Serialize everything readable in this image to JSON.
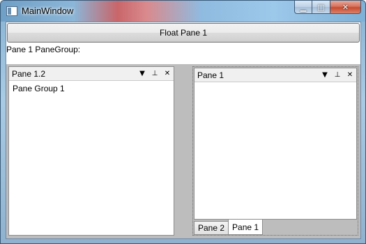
{
  "window": {
    "title": "MainWindow",
    "icon": "window-app-icon",
    "minimize_glyph": "▁",
    "maximize_glyph": "□",
    "close_glyph": "✕"
  },
  "toolbar": {
    "float_button_label": "Float Pane 1"
  },
  "pane_group_label": "Pane 1 PaneGroup:",
  "panes": {
    "left": {
      "title": "Pane 1.2",
      "content": "Pane Group 1",
      "menu_icon": "▼",
      "pin_icon": "⊥",
      "close_icon": "✕"
    },
    "right": {
      "title": "Pane 1",
      "content": "",
      "menu_icon": "▼",
      "pin_icon": "⊥",
      "close_icon": "✕",
      "tabs": [
        "Pane 2",
        "Pane 1"
      ],
      "active_tab": "Pane 1"
    }
  },
  "colors": {
    "dock_background": "#bdbdbd",
    "pane_header": "#f0f0f0"
  }
}
